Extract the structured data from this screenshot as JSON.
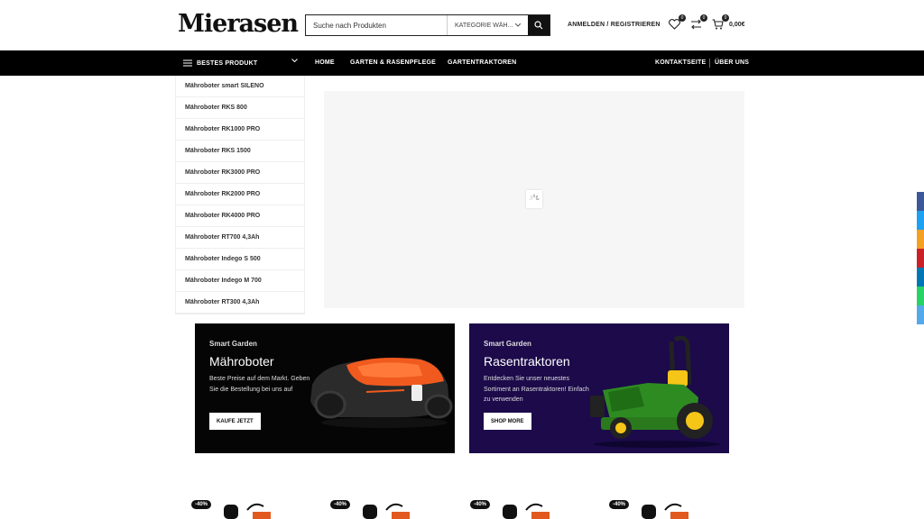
{
  "header": {
    "logo": "Mierasen",
    "search_placeholder": "Suche nach Produkten",
    "search_category": "KATEGORIE WÄH...",
    "account_label": "ANMELDEN / REGISTRIEREN",
    "wishlist_count": "0",
    "compare_count": "0",
    "cart_count": "0",
    "cart_total": "0,00€"
  },
  "nav": {
    "category_toggle": "BESTES PRODUKT",
    "links": [
      "HOME",
      "GARTEN & RASENPFLEGE",
      "GARTENTRAKTOREN"
    ],
    "right_links": [
      "KONTAKTSEITE",
      "ÜBER UNS"
    ]
  },
  "categories": [
    "Mähroboter smart SILENO",
    "Mähroboter RKS 800",
    "Mähroboter RK1000 PRO",
    "Mähroboter RKS 1500",
    "Mähroboter RK3000 PRO",
    "Mähroboter RK2000 PRO",
    "Mähroboter RK4000 PRO",
    "Mähroboter RT700 4,3Ah",
    "Mähroboter Indego S 500",
    "Mähroboter Indego M 700",
    "Mähroboter RT300 4,3Ah"
  ],
  "banners": [
    {
      "tag": "Smart Garden",
      "title": "Mähroboter",
      "desc": "Beste Preise auf dem Markt. Geben Sie die Bestellung bei uns auf",
      "button": "KAUFE JETZT",
      "bg": "#050505"
    },
    {
      "tag": "Smart Garden",
      "title": "Rasentraktoren",
      "desc": "Entdecken Sie unser neuestes Sortiment an Rasentraktoren! Einfach zu verwenden",
      "button": "SHOP MORE",
      "bg": "#1c0a4a"
    }
  ],
  "products": [
    {
      "discount": "-40%"
    },
    {
      "discount": "-40%"
    },
    {
      "discount": "-40%"
    },
    {
      "discount": "-40%"
    }
  ],
  "share_colors": [
    "#3b5998",
    "#1da1f2",
    "#f4a020",
    "#cb2027",
    "#0077b5",
    "#25d366",
    "#54a9eb"
  ]
}
